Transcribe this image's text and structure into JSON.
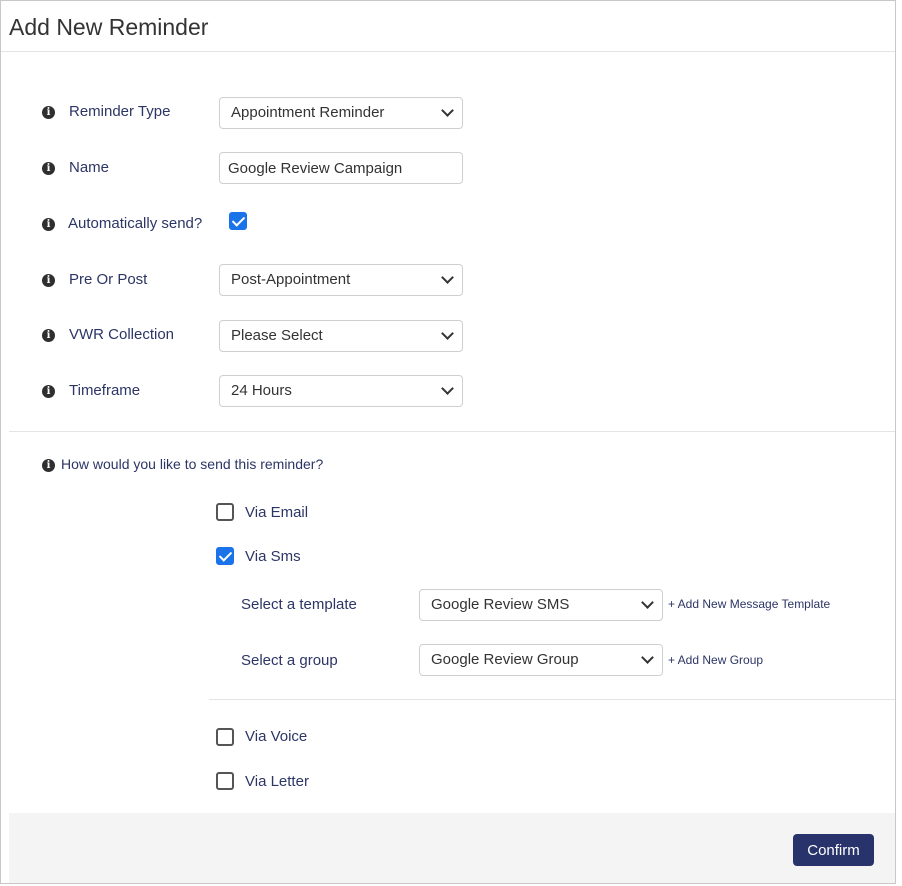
{
  "header": {
    "title": "Add New Reminder"
  },
  "form": {
    "reminder_type": {
      "label": "Reminder Type",
      "value": "Appointment Reminder"
    },
    "name": {
      "label": "Name",
      "value": "Google Review Campaign"
    },
    "auto_send": {
      "label": "Automatically send?",
      "checked": true
    },
    "pre_post": {
      "label": "Pre Or Post",
      "value": "Post-Appointment"
    },
    "vwr_collection": {
      "label": "VWR Collection",
      "value": "Please Select"
    },
    "timeframe": {
      "label": "Timeframe",
      "value": "24 Hours"
    }
  },
  "send": {
    "question": "How would you like to send this reminder?",
    "via_email": {
      "label": "Via Email",
      "checked": false
    },
    "via_sms": {
      "label": "Via Sms",
      "checked": true,
      "template": {
        "label": "Select a template",
        "value": "Google Review SMS",
        "add_link": "+ Add New Message Template"
      },
      "group": {
        "label": "Select a group",
        "value": "Google Review Group",
        "add_link": "+ Add New Group"
      }
    },
    "via_voice": {
      "label": "Via Voice",
      "checked": false
    },
    "via_letter": {
      "label": "Via Letter",
      "checked": false
    }
  },
  "footer": {
    "confirm_label": "Confirm"
  },
  "colors": {
    "label_text": "#2c3565",
    "checkbox_accent": "#1a73e8",
    "confirm_bg": "#28336b",
    "footer_bg": "#f4f4f4"
  },
  "icons": {
    "info": "info-icon",
    "chevron": "chevron-down-icon"
  }
}
